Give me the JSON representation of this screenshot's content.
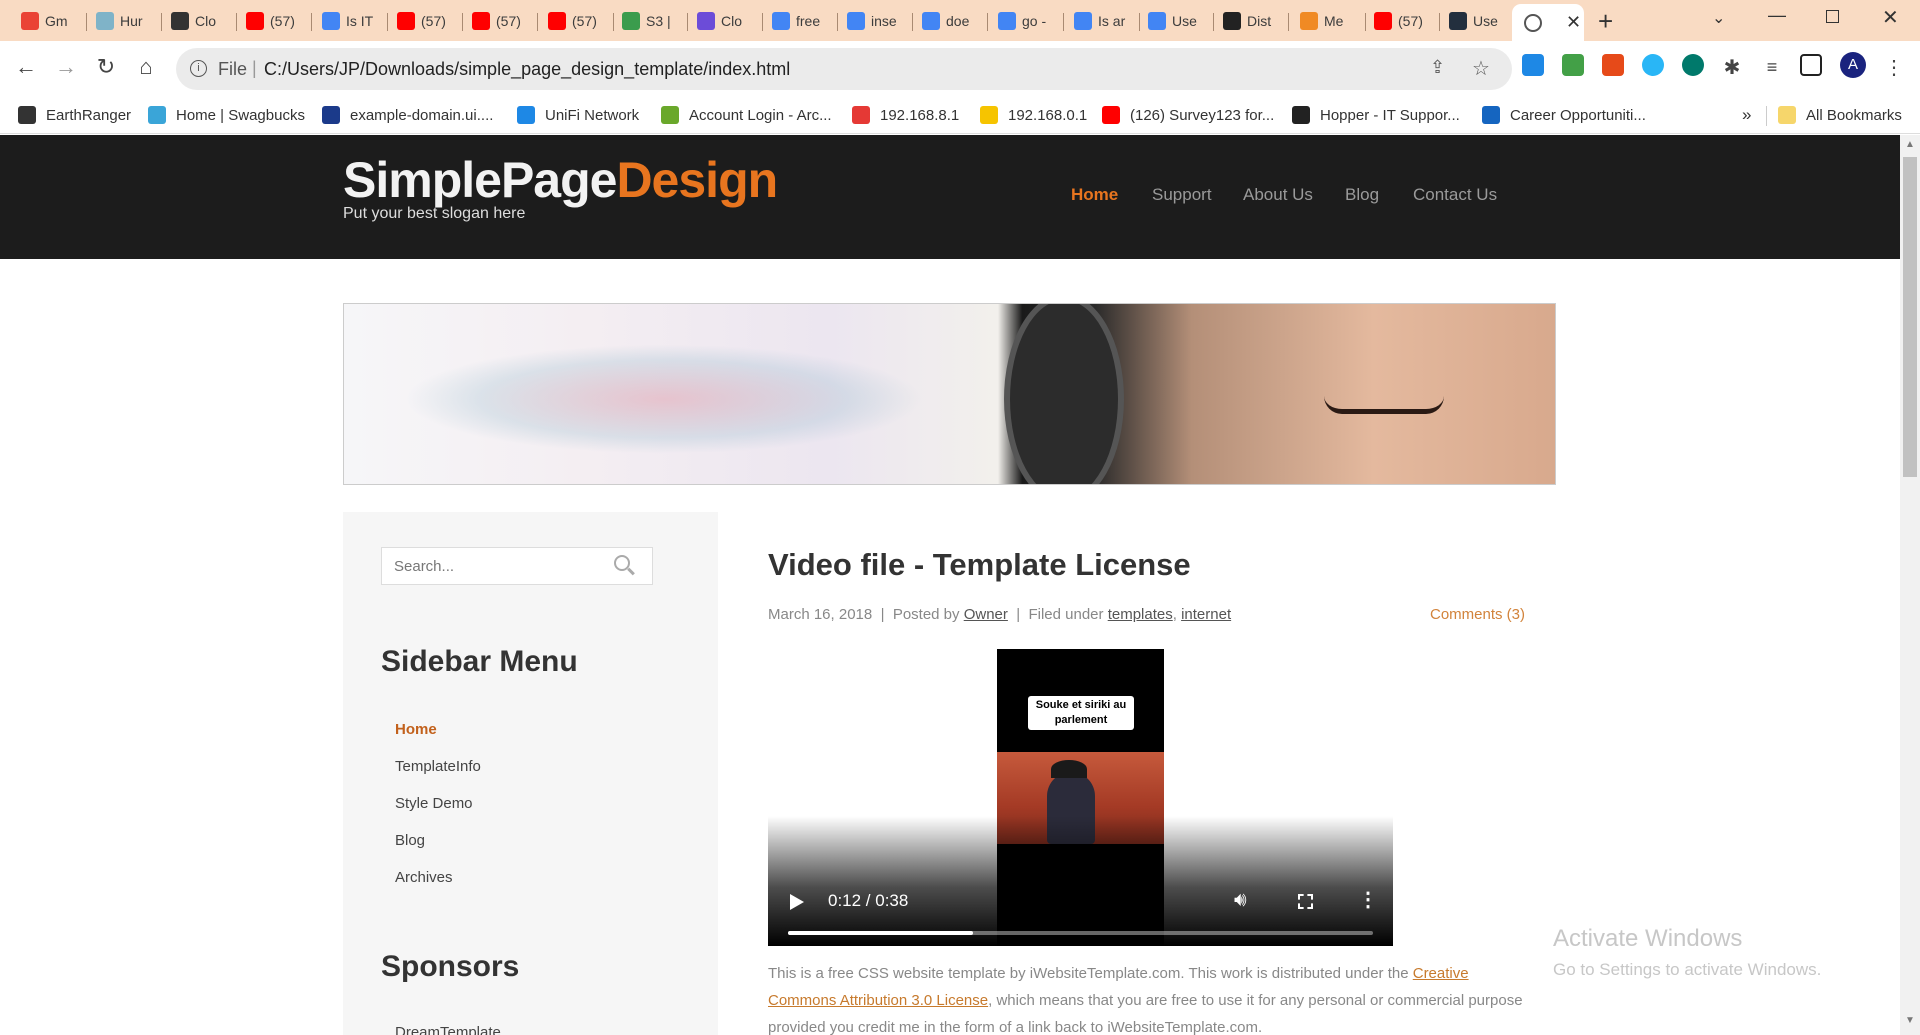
{
  "browser": {
    "tabs": [
      {
        "label": "Gm",
        "icon": "gmail-icon",
        "color": "#ea4335"
      },
      {
        "label": "Hur",
        "icon": "site-icon",
        "color": "#7fb3c8"
      },
      {
        "label": "Clo",
        "icon": "phone-icon",
        "color": "#333333"
      },
      {
        "label": "(57)",
        "icon": "youtube-icon",
        "color": "#ff0000"
      },
      {
        "label": "Is IT",
        "icon": "google-icon",
        "color": "#4285f4"
      },
      {
        "label": "(57)",
        "icon": "youtube-icon",
        "color": "#ff0000"
      },
      {
        "label": "(57)",
        "icon": "youtube-icon",
        "color": "#ff0000"
      },
      {
        "label": "(57)",
        "icon": "youtube-icon",
        "color": "#ff0000"
      },
      {
        "label": "S3 |",
        "icon": "s3-icon",
        "color": "#3b9c4d"
      },
      {
        "label": "Clo",
        "icon": "cloud-icon",
        "color": "#6c4cd8"
      },
      {
        "label": "free",
        "icon": "google-icon",
        "color": "#4285f4"
      },
      {
        "label": "inse",
        "icon": "google-icon",
        "color": "#4285f4"
      },
      {
        "label": "doe",
        "icon": "google-icon",
        "color": "#4285f4"
      },
      {
        "label": "go -",
        "icon": "google-icon",
        "color": "#4285f4"
      },
      {
        "label": "Is ar",
        "icon": "google-icon",
        "color": "#4285f4"
      },
      {
        "label": "Use",
        "icon": "google-icon",
        "color": "#4285f4"
      },
      {
        "label": "Dist",
        "icon": "dist-icon",
        "color": "#222222"
      },
      {
        "label": "Me",
        "icon": "cube-icon",
        "color": "#f08a24"
      },
      {
        "label": "(57)",
        "icon": "youtube-icon",
        "color": "#ff0000"
      },
      {
        "label": "Use",
        "icon": "aws-icon",
        "color": "#232f3e"
      }
    ],
    "url_scheme": "File",
    "url": "C:/Users/JP/Downloads/simple_page_design_template/index.html",
    "bookmarks": [
      {
        "label": "EarthRanger",
        "color": "#333333"
      },
      {
        "label": "Home | Swagbucks",
        "color": "#3aa5d8"
      },
      {
        "label": "example-domain.ui....",
        "color": "#1b3a8a"
      },
      {
        "label": "UniFi Network",
        "color": "#1e88e5"
      },
      {
        "label": "Account Login - Arc...",
        "color": "#6aa82b"
      },
      {
        "label": "192.168.8.1",
        "color": "#e53935"
      },
      {
        "label": "192.168.0.1",
        "color": "#f6c400"
      },
      {
        "label": "(126) Survey123 for...",
        "color": "#ff0000"
      },
      {
        "label": "Hopper - IT Suppor...",
        "color": "#222222"
      },
      {
        "label": "Career Opportuniti...",
        "color": "#1565c0"
      }
    ],
    "bookmarks_overflow": "»",
    "all_bookmarks": "All Bookmarks"
  },
  "site": {
    "logo_part1": "SimplePage",
    "logo_part2": "Design",
    "slogan": "Put your best slogan here",
    "nav": [
      "Home",
      "Support",
      "About Us",
      "Blog",
      "Contact Us"
    ],
    "accent": "#e8751f"
  },
  "sidebar": {
    "search_placeholder": "Search...",
    "menu_title": "Sidebar Menu",
    "menu_items": [
      "Home",
      "TemplateInfo",
      "Style Demo",
      "Blog",
      "Archives"
    ],
    "sponsors_title": "Sponsors",
    "sponsor_partial": "DreamTemplate"
  },
  "post": {
    "title": "Video file - Template License",
    "date": "March 16, 2018",
    "posted_by_label": "Posted by",
    "author": "Owner",
    "filed_under_label": "Filed under",
    "tag1": "templates",
    "tag2": "internet",
    "comments": "Comments (3)",
    "video": {
      "caption": "Souke et siriki au parlement",
      "time": "0:12 / 0:38",
      "progress": 0.316
    },
    "body_part1": "This is a free CSS website template by iWebsiteTemplate.com. This work is distributed under the ",
    "body_link": "Creative Commons Attribution 3.0 License",
    "body_part2": ", which means that you are free to use it for any personal or commercial purpose provided you credit me in the form of a link back to iWebsiteTemplate.com."
  },
  "windows_watermark": {
    "title": "Activate Windows",
    "subtitle": "Go to Settings to activate Windows."
  }
}
